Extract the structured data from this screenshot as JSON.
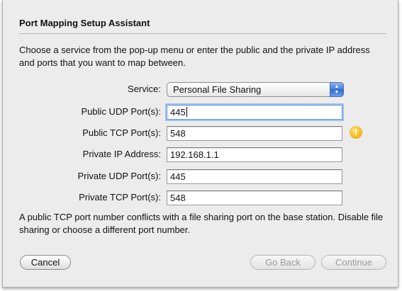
{
  "dialog": {
    "title": "Port Mapping Setup Assistant",
    "description": "Choose a service from the pop-up menu or enter the public and the private IP address and ports that you want to map between."
  },
  "form": {
    "service_label": "Service:",
    "service_value": "Personal File Sharing",
    "public_udp_label": "Public UDP Port(s):",
    "public_udp_value": "445",
    "public_tcp_label": "Public TCP Port(s):",
    "public_tcp_value": "548",
    "private_ip_label": "Private IP Address:",
    "private_ip_value": "192.168.1.1",
    "private_udp_label": "Private UDP Port(s):",
    "private_udp_value": "445",
    "private_tcp_label": "Private TCP Port(s):",
    "private_tcp_value": "548"
  },
  "warning": {
    "icon": "warning-icon",
    "glyph": "!",
    "message": "A public TCP port number conflicts with a file sharing port on the base station. Disable file sharing or choose a different port number."
  },
  "buttons": {
    "cancel": "Cancel",
    "go_back": "Go Back",
    "continue": "Continue"
  },
  "colors": {
    "warning": "#f3b20f",
    "focus_ring": "#9fc1ee",
    "popup_accent": "#3d7bdb"
  }
}
